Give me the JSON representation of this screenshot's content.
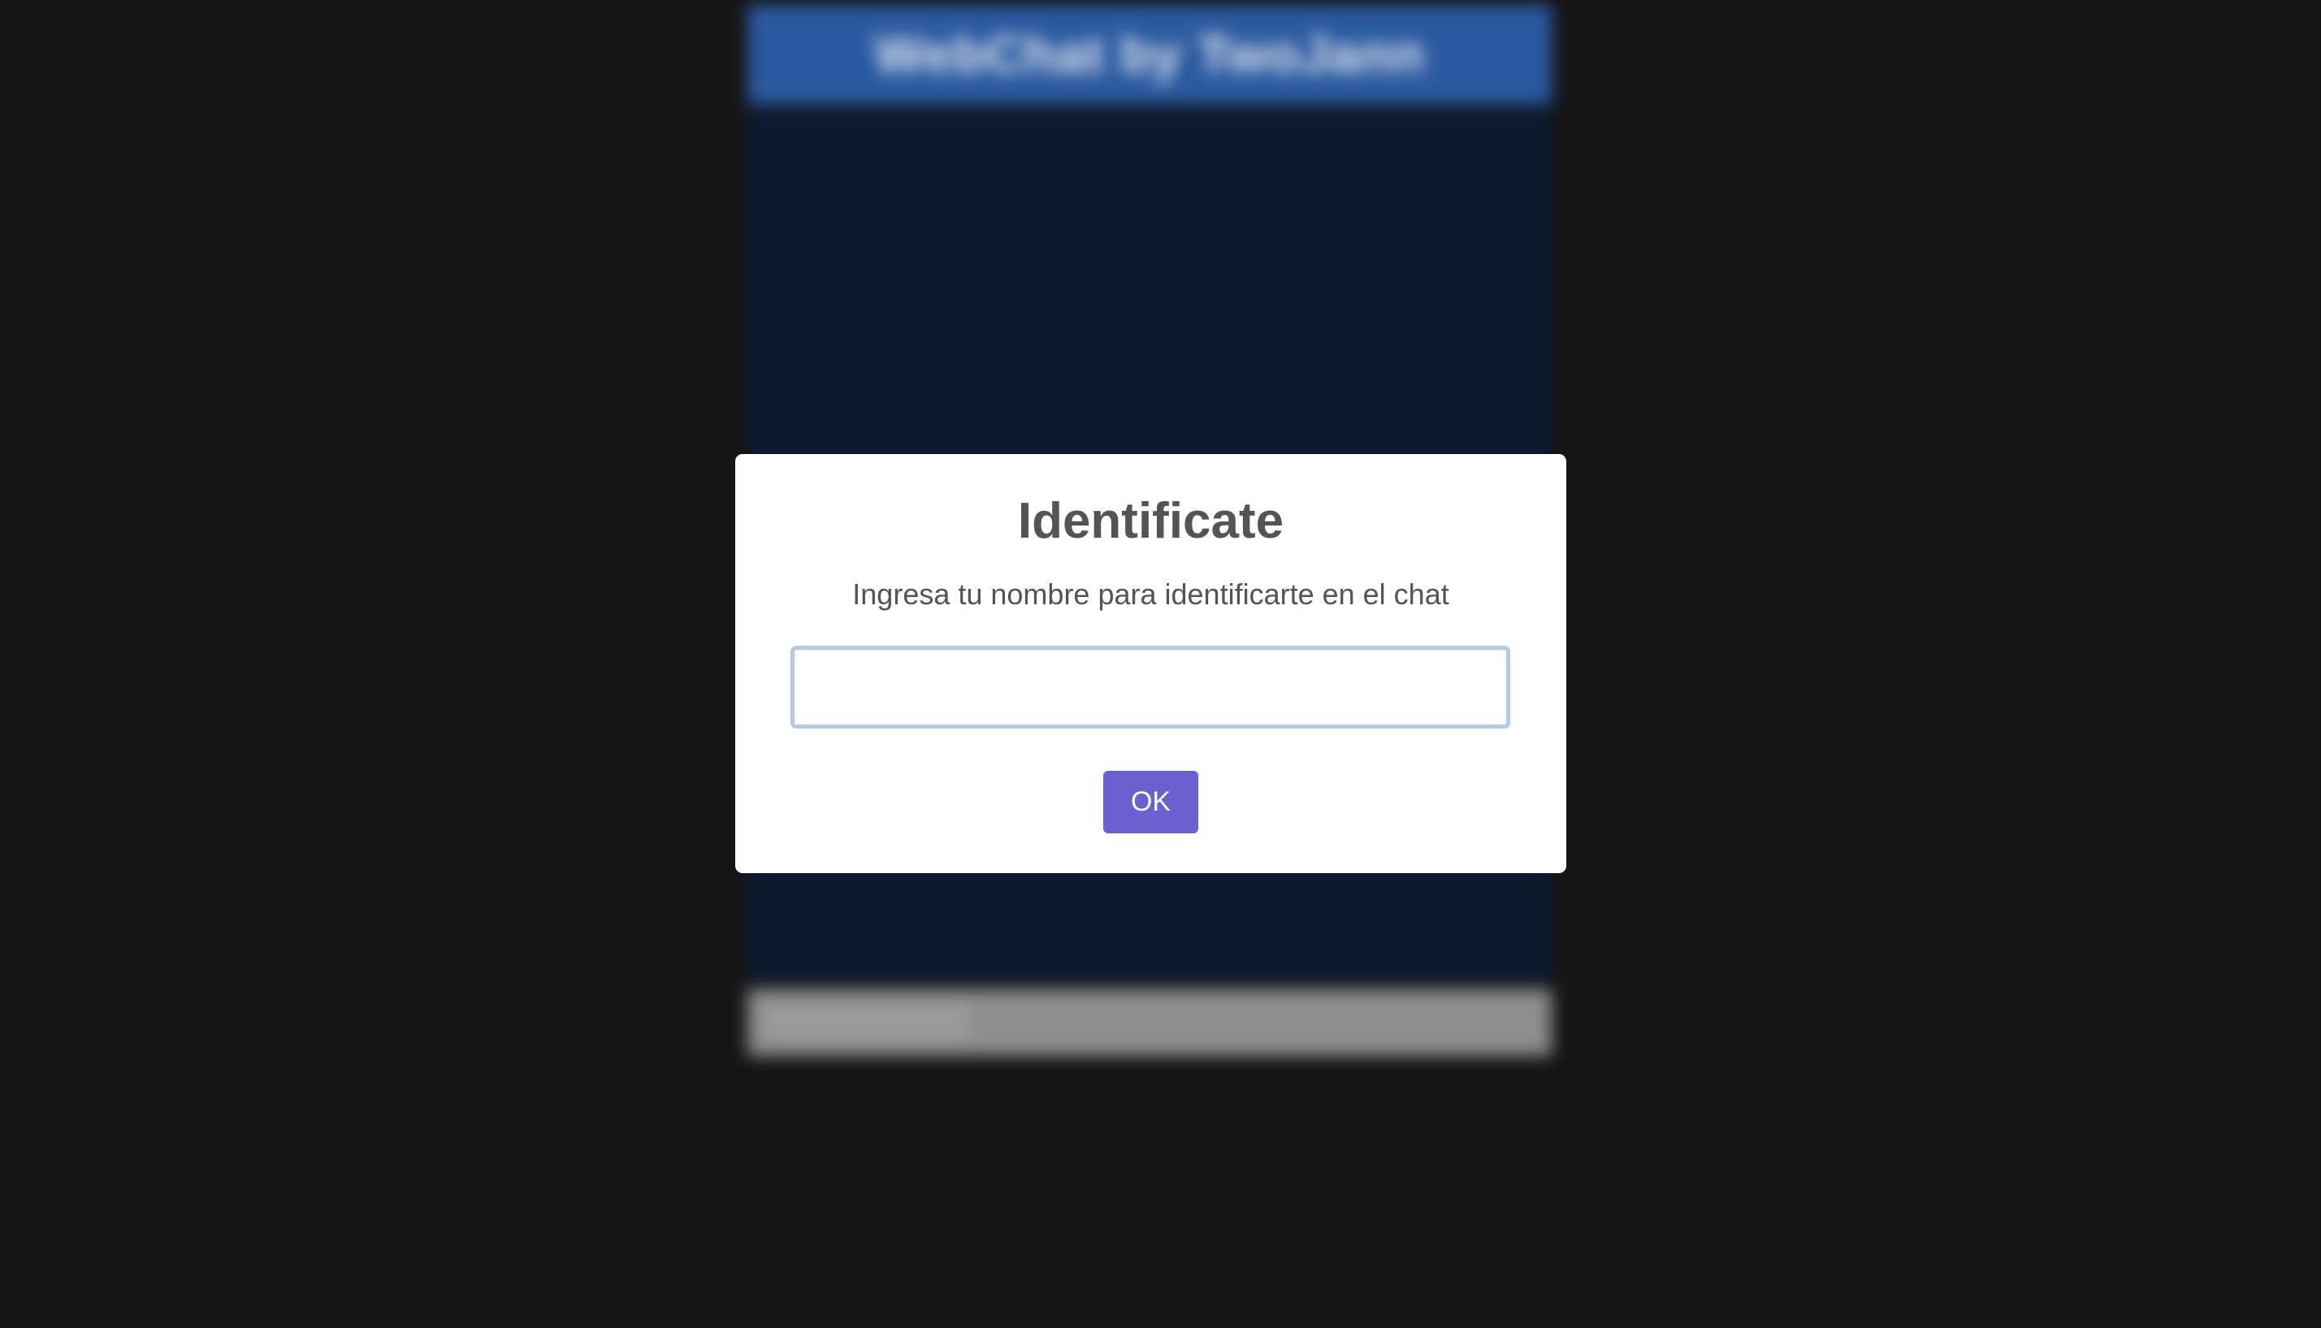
{
  "background_app": {
    "header_title": "WebChat by TwoJann",
    "colors": {
      "header": "#2b5aa0",
      "messages_area": "#0d1a2e",
      "input_bar": "#8e8e8e",
      "page": "#151515"
    }
  },
  "modal": {
    "title": "Identificate",
    "text": "Ingresa tu nombre para identificarte en el chat",
    "input": {
      "value": "",
      "placeholder": ""
    },
    "ok_label": "OK",
    "colors": {
      "button": "#6c5fcf",
      "input_border": "#b4cbe3"
    }
  }
}
